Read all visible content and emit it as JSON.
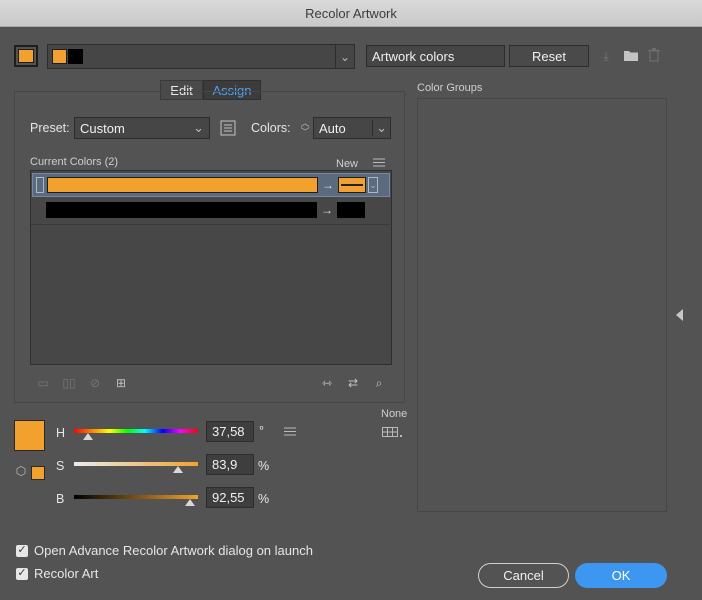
{
  "window": {
    "title": "Recolor Artwork"
  },
  "top": {
    "name_field": "Artwork colors",
    "reset_label": "Reset"
  },
  "tabs": [
    {
      "label": "Edit",
      "active": false
    },
    {
      "label": "Assign",
      "active": true
    }
  ],
  "assign": {
    "preset_label": "Preset:",
    "preset_value": "Custom",
    "colors_label": "Colors:",
    "colors_value": "Auto",
    "current_colors_label": "Current Colors (2)",
    "new_label": "New",
    "rows": [
      {
        "current": "#f2a12e",
        "new": "#f2a12e",
        "selected": true
      },
      {
        "current": "#000000",
        "new": "#000000",
        "selected": false
      }
    ]
  },
  "color_groups": {
    "label": "Color Groups"
  },
  "hsb": {
    "h_label": "H",
    "h_value": "37,58",
    "h_unit": "°",
    "s_label": "S",
    "s_value": "83,9",
    "s_unit": "%",
    "b_label": "B",
    "b_value": "92,55",
    "b_unit": "%",
    "none_label": "None"
  },
  "options": {
    "open_advance_label": "Open Advance Recolor Artwork dialog on launch",
    "recolor_art_label": "Recolor Art"
  },
  "footer": {
    "cancel_label": "Cancel",
    "ok_label": "OK"
  },
  "colors": {
    "accent": "#f2a12e",
    "primary_button": "#3d97f0"
  }
}
